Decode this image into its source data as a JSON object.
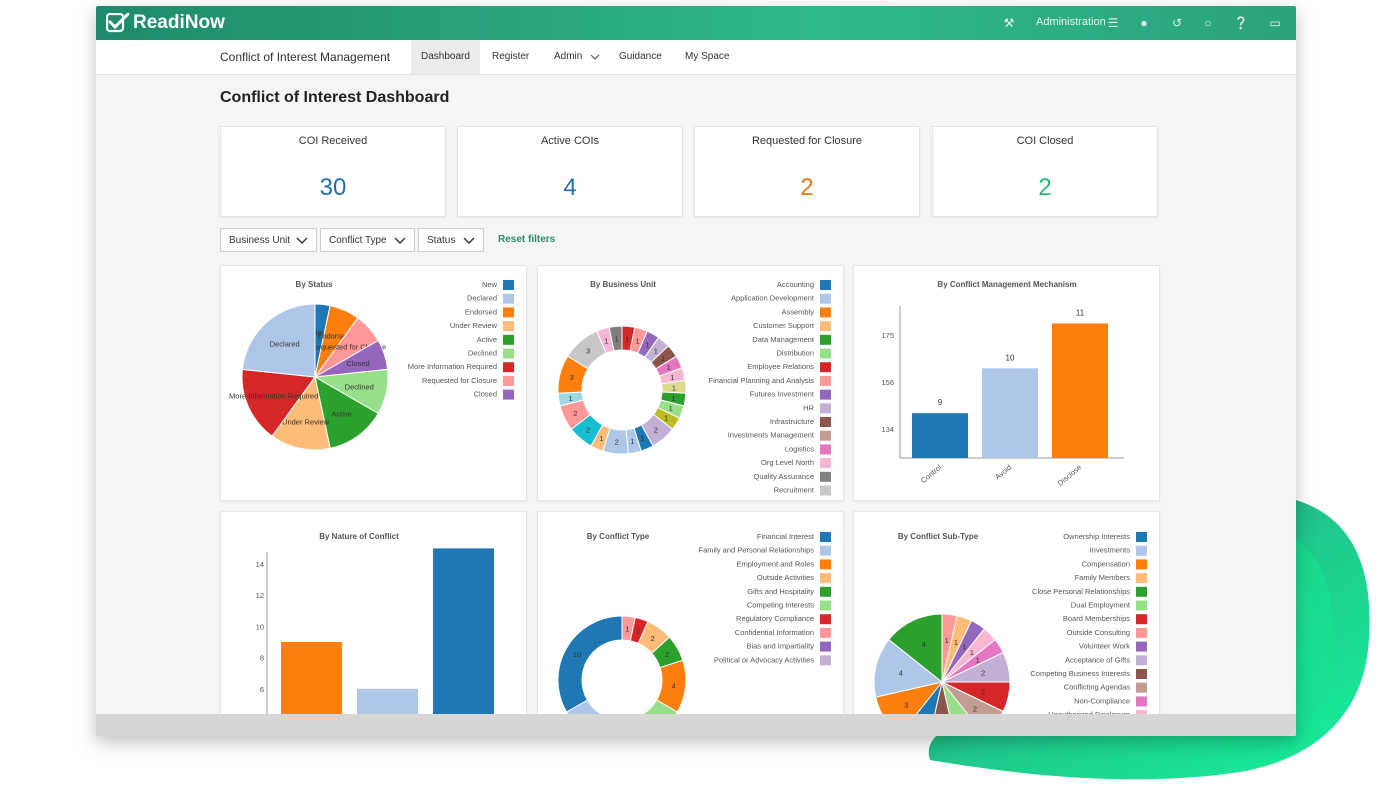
{
  "app": {
    "name": "ReadiNow",
    "module_title": "Conflict of Interest Management",
    "admin_label": "Administration"
  },
  "nav": [
    {
      "label": "Dashboard",
      "active": true
    },
    {
      "label": "Register"
    },
    {
      "label": "Admin"
    },
    {
      "label": "Guidance"
    },
    {
      "label": "My Space"
    }
  ],
  "icons": [
    "wrench-icon",
    "menu-icon",
    "user-icon",
    "history-icon",
    "chat-icon",
    "help-icon",
    "window-icon"
  ],
  "page_title": "Conflict of Interest Dashboard",
  "kpis": [
    {
      "label": "COI Received",
      "value": "30",
      "color": "#1f6fb5"
    },
    {
      "label": "Active COIs",
      "value": "4",
      "color": "#1f6fb5"
    },
    {
      "label": "Requested for Closure",
      "value": "2",
      "color": "#e07b1a"
    },
    {
      "label": "COI Closed",
      "value": "2",
      "color": "#2bb673"
    }
  ],
  "filters": [
    {
      "label": "Business Unit"
    },
    {
      "label": "Conflict Type"
    },
    {
      "label": "Status"
    }
  ],
  "reset_label": "Reset filters",
  "chart_data": [
    {
      "type": "pie",
      "title": "By Status",
      "legend_position": "top-right",
      "labels": [
        "New",
        "Declared",
        "Endorsed",
        "Under Review",
        "Active",
        "Declined",
        "More Information Required",
        "Requested for Closure",
        "Closed"
      ],
      "colors": [
        "#1f77b4",
        "#aec7e8",
        "#ff7f0e",
        "#ffbb78",
        "#2ca02c",
        "#98df8a",
        "#d62728",
        "#ff9896",
        "#9467bd"
      ],
      "values": [
        1,
        7,
        2,
        0,
        4,
        3,
        5,
        2,
        2
      ],
      "slices": [
        {
          "label": "New",
          "value": 1,
          "color": "#1f77b4"
        },
        {
          "label": "Endorsed",
          "value": 2,
          "color": "#ff7f0e"
        },
        {
          "label": "Requested for Closure",
          "value": 2,
          "color": "#ff9896"
        },
        {
          "label": "Closed",
          "value": 2,
          "color": "#9467bd"
        },
        {
          "label": "Declined",
          "value": 3,
          "color": "#98df8a"
        },
        {
          "label": "Active",
          "value": 4,
          "color": "#2ca02c"
        },
        {
          "label": "Under Review",
          "value": 4,
          "color": "#ffbb78"
        },
        {
          "label": "More Information Required",
          "value": 5,
          "color": "#d62728"
        },
        {
          "label": "Declared",
          "value": 7,
          "color": "#aec7e8"
        }
      ]
    },
    {
      "type": "pie",
      "title": "By Business Unit",
      "donut": true,
      "legend_position": "top-right",
      "labels": [
        "Accounting",
        "Application Development",
        "Assembly",
        "Customer Support",
        "Data Management",
        "Distribution",
        "Employee Relations",
        "Financial Planning and Analysis",
        "Futures Investment",
        "HR",
        "Infrastructure",
        "Investments Management",
        "Logistics",
        "Org Level North",
        "Quality Assurance",
        "Recruitment"
      ],
      "colors": [
        "#1f77b4",
        "#aec7e8",
        "#ff7f0e",
        "#ffbb78",
        "#2ca02c",
        "#98df8a",
        "#d62728",
        "#ff9896",
        "#9467bd",
        "#c5b0d5",
        "#8c564b",
        "#c49c94",
        "#e377c2",
        "#f7b6d2",
        "#7f7f7f",
        "#c7c7c7"
      ],
      "slices": [
        {
          "value": 1,
          "color": "#d62728",
          "label": "1"
        },
        {
          "value": 1,
          "color": "#ff9896",
          "label": "1"
        },
        {
          "value": 1,
          "color": "#9467bd",
          "label": "1"
        },
        {
          "value": 1,
          "color": "#c5b0d5",
          "label": "1"
        },
        {
          "value": 1,
          "color": "#8c564b",
          "label": "1"
        },
        {
          "value": 1,
          "color": "#e377c2",
          "label": "1"
        },
        {
          "value": 1,
          "color": "#f7b6d2",
          "label": "1"
        },
        {
          "value": 1,
          "color": "#dbdb8d",
          "label": "1"
        },
        {
          "value": 1,
          "color": "#2ca02c",
          "label": "1"
        },
        {
          "value": 1,
          "color": "#98df8a",
          "label": "1"
        },
        {
          "value": 1,
          "color": "#bcbd22",
          "label": "1"
        },
        {
          "value": 2,
          "color": "#c5b0d5",
          "label": "2"
        },
        {
          "value": 1,
          "color": "#1f77b4",
          "label": "1"
        },
        {
          "value": 1,
          "color": "#aec7e8",
          "label": "1"
        },
        {
          "value": 2,
          "color": "#aec7e8",
          "label": "2"
        },
        {
          "value": 1,
          "color": "#ffbb78",
          "label": "1"
        },
        {
          "value": 2,
          "color": "#17becf",
          "label": "2"
        },
        {
          "value": 2,
          "color": "#ff9896",
          "label": "2"
        },
        {
          "value": 1,
          "color": "#9edae5",
          "label": "1"
        },
        {
          "value": 3,
          "color": "#ff7f0e",
          "label": "3"
        },
        {
          "value": 3,
          "color": "#c7c7c7",
          "label": "3"
        },
        {
          "value": 1,
          "color": "#f7b6d2",
          "label": "1"
        },
        {
          "value": 1,
          "color": "#7f7f7f",
          "label": "1"
        }
      ]
    },
    {
      "type": "bar",
      "title": "By Conflict Management Mechanism",
      "categories": [
        "Control",
        "Avoid",
        "Disclose"
      ],
      "values": [
        9,
        10,
        11
      ],
      "colors": [
        "#1f77b4",
        "#aec7e8",
        "#ff7f0e"
      ],
      "y_ticks": [
        "134",
        "156",
        "175"
      ],
      "grid": false
    },
    {
      "type": "bar",
      "title": "By Nature of Conflict",
      "categories": [
        "",
        "",
        ""
      ],
      "values": [
        9,
        6,
        15
      ],
      "colors": [
        "#ff7f0e",
        "#aec7e8",
        "#1f77b4"
      ],
      "ylim": [
        4,
        15
      ],
      "y_ticks": [
        4,
        6,
        8,
        10,
        12,
        14
      ],
      "grid": false
    },
    {
      "type": "pie",
      "title": "By Conflict Type",
      "donut": true,
      "legend_position": "top-right",
      "labels": [
        "Financial Interest",
        "Family and Personal Relationships",
        "Employment and Roles",
        "Outside Activities",
        "Gifts and Hospitality",
        "Competing Interests",
        "Regulatory Compliance",
        "Confidential Information",
        "Bias and Impartiality",
        "Political or Advocacy Activities"
      ],
      "colors": [
        "#1f77b4",
        "#aec7e8",
        "#ff7f0e",
        "#ffbb78",
        "#2ca02c",
        "#98df8a",
        "#d62728",
        "#ff9896",
        "#9467bd",
        "#c5b0d5"
      ],
      "slices": [
        {
          "value": 1,
          "color": "#ff9896",
          "label": "1"
        },
        {
          "value": 1,
          "color": "#d62728",
          "label": "1"
        },
        {
          "value": 2,
          "color": "#ffbb78",
          "label": "2"
        },
        {
          "value": 2,
          "color": "#2ca02c",
          "label": "2"
        },
        {
          "value": 4,
          "color": "#ff7f0e",
          "label": "4"
        },
        {
          "value": 5,
          "color": "#98df8a",
          "label": "5"
        },
        {
          "value": 5,
          "color": "#aec7e8",
          "label": "5"
        },
        {
          "value": 10,
          "color": "#1f77b4",
          "label": "10"
        }
      ]
    },
    {
      "type": "pie",
      "title": "By Conflict Sub-Type",
      "legend_position": "top-right",
      "labels": [
        "Ownership Interests",
        "Investments",
        "Compensation",
        "Family Members",
        "Close Personal Relationships",
        "Dual Employment",
        "Board Memberships",
        "Outside Consulting",
        "Volunteer Work",
        "Acceptance of Gifts",
        "Competing Business Interests",
        "Conflicting Agendas",
        "Non-Compliance",
        "Unauthorized Disclosure"
      ],
      "colors": [
        "#1f77b4",
        "#aec7e8",
        "#ff7f0e",
        "#ffbb78",
        "#2ca02c",
        "#98df8a",
        "#d62728",
        "#ff9896",
        "#9467bd",
        "#c5b0d5",
        "#8c564b",
        "#c49c94",
        "#e377c2",
        "#f7b6d2"
      ],
      "slices": [
        {
          "value": 1,
          "color": "#ff9896",
          "label": "1"
        },
        {
          "value": 1,
          "color": "#ffbb78",
          "label": "1"
        },
        {
          "value": 1,
          "color": "#9467bd",
          "label": "1"
        },
        {
          "value": 1,
          "color": "#f7b6d2",
          "label": "1"
        },
        {
          "value": 1,
          "color": "#e377c2",
          "label": "1"
        },
        {
          "value": 2,
          "color": "#c5b0d5",
          "label": "2"
        },
        {
          "value": 2,
          "color": "#d62728",
          "label": "2"
        },
        {
          "value": 2,
          "color": "#c49c94",
          "label": "2"
        },
        {
          "value": 2,
          "color": "#98df8a",
          "label": "2"
        },
        {
          "value": 2,
          "color": "#8c564b",
          "label": ""
        },
        {
          "value": 2,
          "color": "#1f77b4",
          "label": ""
        },
        {
          "value": 3,
          "color": "#ff7f0e",
          "label": "3"
        },
        {
          "value": 4,
          "color": "#aec7e8",
          "label": "4"
        },
        {
          "value": 4,
          "color": "#2ca02c",
          "label": "4"
        }
      ]
    }
  ]
}
